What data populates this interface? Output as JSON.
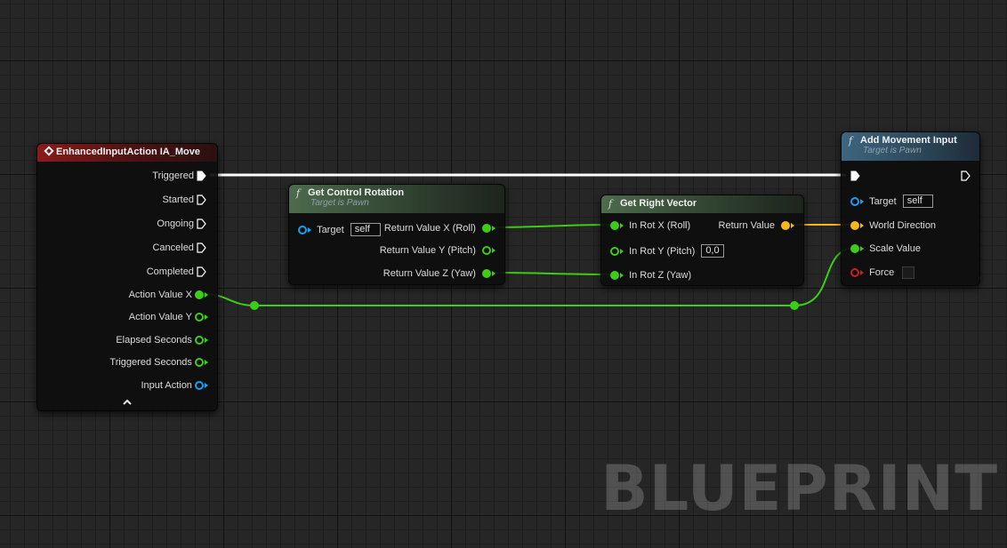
{
  "nodes": {
    "enhanced_input": {
      "title": "EnhancedInputAction IA_Move",
      "pins": {
        "triggered": "Triggered",
        "started": "Started",
        "ongoing": "Ongoing",
        "canceled": "Canceled",
        "completed": "Completed",
        "action_value_x": "Action Value X",
        "action_value_y": "Action Value Y",
        "elapsed_seconds": "Elapsed Seconds",
        "triggered_seconds": "Triggered Seconds",
        "input_action": "Input Action"
      },
      "collapse_icon": "chevron-up-icon"
    },
    "get_control_rotation": {
      "title": "Get Control Rotation",
      "subtitle": "Target is Pawn",
      "target_label": "Target",
      "target_value": "self",
      "outputs": {
        "x": "Return Value X (Roll)",
        "y": "Return Value Y (Pitch)",
        "z": "Return Value Z (Yaw)"
      }
    },
    "get_right_vector": {
      "title": "Get Right Vector",
      "inputs": {
        "x": "In Rot X (Roll)",
        "y": "In Rot Y (Pitch)",
        "z": "In Rot Z (Yaw)"
      },
      "y_value": "0,0",
      "output": "Return Value"
    },
    "add_movement_input": {
      "title": "Add Movement Input",
      "subtitle": "Target is Pawn",
      "target_label": "Target",
      "target_value": "self",
      "world_direction": "World Direction",
      "scale_value": "Scale Value",
      "force": "Force"
    }
  },
  "colors": {
    "exec": "#ffffff",
    "float": "#3ccd16",
    "vector": "#f7b81e",
    "object": "#18a0f0",
    "bool": "#c82020"
  },
  "watermark": "BLUEPRINT"
}
